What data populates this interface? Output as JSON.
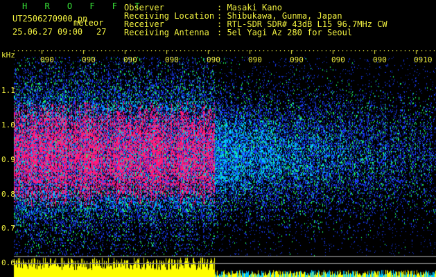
{
  "header": {
    "title": "H R O F F T",
    "filename": "UT2506270900.pn",
    "type_label": "meteor",
    "date": "25.06.27 09:00",
    "count": "27",
    "info": [
      {
        "label": "Observer",
        "value": ": Masaki Kano"
      },
      {
        "label": "Receiving Location",
        "value": ": Shibukawa, Gunma, Japan"
      },
      {
        "label": "Receiver",
        "value": ": RTL-SDR SDR# 43dB L15 96.7MHz CW"
      },
      {
        "label": "Receiving Antenna",
        "value": ": 5el Yagi Az 280 for Seoul"
      }
    ]
  },
  "y_axis": {
    "unit": "kHz",
    "ticks": [
      "1.1",
      "1.0",
      "0.9",
      "0.8",
      "0.7",
      "0.6"
    ]
  },
  "x_axis": {
    "ticks": [
      "090",
      "090",
      "090",
      "090",
      "090",
      "090",
      "090",
      "090",
      "090",
      "0910"
    ]
  },
  "colors": {
    "text": "#f2f240",
    "title": "#39e639",
    "dense": "#ff1a7a",
    "medium": "#00c8ff",
    "low": "#1a3cff",
    "power": "#ffff00"
  }
}
